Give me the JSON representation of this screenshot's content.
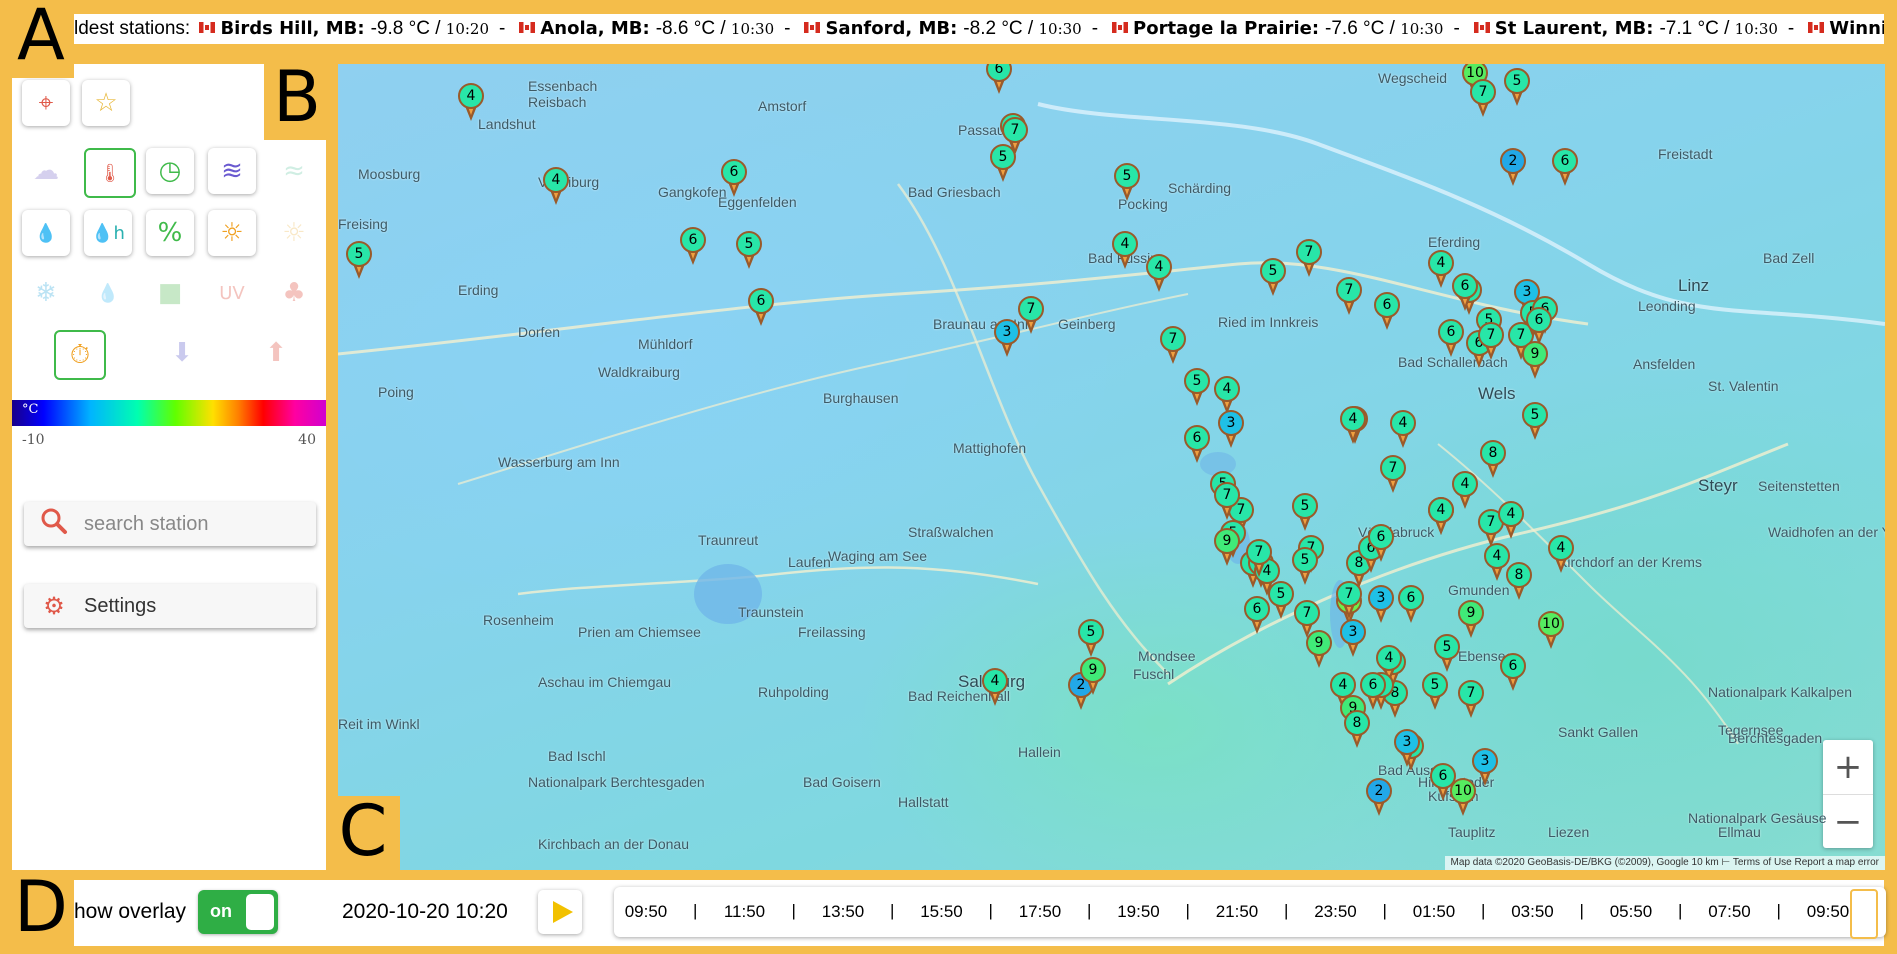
{
  "panel_labels": [
    "A",
    "B",
    "C",
    "D"
  ],
  "ticker": {
    "prefix": "ldest stations:",
    "items": [
      {
        "name": "Birds Hill, MB:",
        "temp": "-9.8 °C",
        "time": "10:20"
      },
      {
        "name": "Anola, MB:",
        "temp": "-8.6 °C",
        "time": "10:30"
      },
      {
        "name": "Sanford, MB:",
        "temp": "-8.2 °C",
        "time": "10:30"
      },
      {
        "name": "Portage la Prairie:",
        "temp": "-7.6 °C",
        "time": "10:30"
      },
      {
        "name": "St Laurent, MB:",
        "temp": "-7.1 °C",
        "time": "10:30"
      },
      {
        "name": "Winnipeg, MB :",
        "temp": "",
        "time": ""
      }
    ]
  },
  "sidebar": {
    "icons": [
      {
        "name": "locate-icon",
        "glyph": "⌖",
        "color": "#e05a4a",
        "faded": false
      },
      {
        "name": "star-icon",
        "glyph": "☆",
        "color": "#e8b83a",
        "faded": false
      },
      {
        "name": "cloud-icon",
        "glyph": "☁",
        "color": "#8a7ad0",
        "faded": true
      },
      {
        "name": "thermometer-icon",
        "glyph": "🌡",
        "color": "#e05a4a",
        "faded": false,
        "active": true
      },
      {
        "name": "gauge-icon",
        "glyph": "◷",
        "color": "#3fba4a",
        "faded": false
      },
      {
        "name": "wind-icon",
        "glyph": "≋",
        "color": "#6a5ad0",
        "faded": false
      },
      {
        "name": "fog-icon",
        "glyph": "≈",
        "color": "#7ad0b0",
        "faded": true
      },
      {
        "name": "water-drop-icon",
        "glyph": "💧",
        "color": "#2a3ad0",
        "faded": false
      },
      {
        "name": "humidity-icon",
        "glyph": "💧h",
        "color": "#2ab0b0",
        "faded": false
      },
      {
        "name": "percent-icon",
        "glyph": "%",
        "color": "#3fba4a",
        "faded": false
      },
      {
        "name": "sun-icon",
        "glyph": "☼",
        "color": "#f0a020",
        "faded": false
      },
      {
        "name": "sun-faded-icon",
        "glyph": "☼",
        "color": "#f0c060",
        "faded": true
      },
      {
        "name": "snowflake-icon",
        "glyph": "❄",
        "color": "#40b0e0",
        "faded": true
      },
      {
        "name": "dew-icon",
        "glyph": "💧",
        "color": "#60c060",
        "faded": true
      },
      {
        "name": "camera-icon",
        "glyph": "■",
        "color": "#60c060",
        "faded": true
      },
      {
        "name": "uv-icon",
        "glyph": "UV",
        "color": "#e05a4a",
        "faded": true
      },
      {
        "name": "people-icon",
        "glyph": "♣",
        "color": "#e05a4a",
        "faded": true
      },
      {
        "name": "timer-icon",
        "glyph": "⏱",
        "color": "#f0a020",
        "faded": false,
        "active": true
      },
      {
        "name": "arrow-down-icon",
        "glyph": "⬇",
        "color": "#6a6ad0",
        "faded": true
      },
      {
        "name": "arrow-up-icon",
        "glyph": "⬆",
        "color": "#e05a4a",
        "faded": true
      }
    ],
    "colorbar": {
      "unit": "°C",
      "min": "-10",
      "max": "40"
    },
    "search_placeholder": "search station",
    "settings_label": "Settings"
  },
  "map": {
    "places": [
      {
        "label": "Essenbach",
        "big": false
      },
      {
        "label": "Landshut",
        "big": false
      },
      {
        "label": "Reisbach",
        "big": false
      },
      {
        "label": "Amstorf",
        "big": false
      },
      {
        "label": "Moosburg",
        "big": false
      },
      {
        "label": "Vilsbiburg",
        "big": false
      },
      {
        "label": "Gangkofen",
        "big": false
      },
      {
        "label": "Eggenfelden",
        "big": false
      },
      {
        "label": "Bad Griesbach",
        "big": false
      },
      {
        "label": "Schärding",
        "big": false
      },
      {
        "label": "Passau",
        "big": false
      },
      {
        "label": "Wegscheid",
        "big": false
      },
      {
        "label": "Freistadt",
        "big": false
      },
      {
        "label": "Freising",
        "big": false
      },
      {
        "label": "Erding",
        "big": false
      },
      {
        "label": "Dorfen",
        "big": false
      },
      {
        "label": "Mühldorf",
        "big": false
      },
      {
        "label": "Pocking",
        "big": false
      },
      {
        "label": "Bad Füssing",
        "big": false
      },
      {
        "label": "Braunau am Inn",
        "big": false
      },
      {
        "label": "Geinberg",
        "big": false
      },
      {
        "label": "Ried im Innkreis",
        "big": false
      },
      {
        "label": "Eferding",
        "big": false
      },
      {
        "label": "Linz",
        "big": true
      },
      {
        "label": "Leonding",
        "big": false
      },
      {
        "label": "Bad Zell",
        "big": false
      },
      {
        "label": "Poing",
        "big": false
      },
      {
        "label": "Waldkraiburg",
        "big": false
      },
      {
        "label": "Burghausen",
        "big": false
      },
      {
        "label": "Bad Schallerbach",
        "big": false
      },
      {
        "label": "Ansfelden",
        "big": false
      },
      {
        "label": "St. Valentin",
        "big": false
      },
      {
        "label": "Wels",
        "big": true
      },
      {
        "label": "Mattighofen",
        "big": false
      },
      {
        "label": "Wasserburg am Inn",
        "big": false
      },
      {
        "label": "Traunreut",
        "big": false
      },
      {
        "label": "Waging am See",
        "big": false
      },
      {
        "label": "Straßwalchen",
        "big": false
      },
      {
        "label": "Vöcklabruck",
        "big": false
      },
      {
        "label": "Kirchdorf an der Krems",
        "big": false
      },
      {
        "label": "Steyr",
        "big": true
      },
      {
        "label": "Seitenstetten",
        "big": false
      },
      {
        "label": "Waidhofen an der Ybbs",
        "big": false
      },
      {
        "label": "Laufen",
        "big": false
      },
      {
        "label": "Freilassing",
        "big": false
      },
      {
        "label": "Rosenheim",
        "big": false
      },
      {
        "label": "Prien am Chiemsee",
        "big": false
      },
      {
        "label": "Traunstein",
        "big": false
      },
      {
        "label": "Mondsee",
        "big": false
      },
      {
        "label": "Gmunden",
        "big": false
      },
      {
        "label": "Salzburg",
        "big": true
      },
      {
        "label": "Fuschl",
        "big": false
      },
      {
        "label": "Ebensee",
        "big": false
      },
      {
        "label": "Aschau im Chiemgau",
        "big": false
      },
      {
        "label": "Ruhpolding",
        "big": false
      },
      {
        "label": "Bad Reichenhall",
        "big": false
      },
      {
        "label": "Hallein",
        "big": false
      },
      {
        "label": "Nationalpark Kalkalpen",
        "big": false
      },
      {
        "label": "Tegernsee",
        "big": false
      },
      {
        "label": "Reit im Winkl",
        "big": false
      },
      {
        "label": "Bad Ischl",
        "big": false
      },
      {
        "label": "Hinterstoder",
        "big": false
      },
      {
        "label": "Sankt Gallen",
        "big": false
      },
      {
        "label": "Berchtesgaden",
        "big": false
      },
      {
        "label": "Bad Goisern",
        "big": false
      },
      {
        "label": "Bad Aussee",
        "big": false
      },
      {
        "label": "Kufstein",
        "big": false
      },
      {
        "label": "Nationalpark Berchtesgaden",
        "big": false
      },
      {
        "label": "Hallstatt",
        "big": false
      },
      {
        "label": "Tauplitz",
        "big": false
      },
      {
        "label": "Liezen",
        "big": false
      },
      {
        "label": "Nationalpark Gesäuse",
        "big": false
      },
      {
        "label": "Ellmau",
        "big": false
      },
      {
        "label": "Kirchbach an der Donau",
        "big": false
      }
    ],
    "markers": [
      {
        "value": 4
      },
      {
        "value": 4
      },
      {
        "value": 5
      },
      {
        "value": 6
      },
      {
        "value": 6
      },
      {
        "value": 5
      },
      {
        "value": 6
      },
      {
        "value": 6
      },
      {
        "value": 5
      },
      {
        "value": 5
      },
      {
        "value": 7
      },
      {
        "value": 5
      },
      {
        "value": 2
      },
      {
        "value": 10
      },
      {
        "value": 7
      },
      {
        "value": 5
      },
      {
        "value": 4
      },
      {
        "value": 6
      },
      {
        "value": 3
      },
      {
        "value": 7
      },
      {
        "value": 5
      },
      {
        "value": 6
      },
      {
        "value": 4
      },
      {
        "value": 6
      },
      {
        "value": 6
      },
      {
        "value": 5
      },
      {
        "value": 6
      },
      {
        "value": 7
      },
      {
        "value": 6
      },
      {
        "value": 6
      },
      {
        "value": 5
      },
      {
        "value": 7
      },
      {
        "value": 7
      },
      {
        "value": 5
      },
      {
        "value": 4
      },
      {
        "value": 4
      },
      {
        "value": 7
      },
      {
        "value": 6
      },
      {
        "value": 7
      },
      {
        "value": 8
      },
      {
        "value": 9
      },
      {
        "value": 5
      },
      {
        "value": 4
      },
      {
        "value": 3
      },
      {
        "value": 5
      },
      {
        "value": 6
      },
      {
        "value": 5
      },
      {
        "value": 7
      },
      {
        "value": 7
      },
      {
        "value": 5
      },
      {
        "value": 3
      },
      {
        "value": 9
      },
      {
        "value": 7
      },
      {
        "value": 4
      },
      {
        "value": 6
      },
      {
        "value": 4
      },
      {
        "value": 4
      },
      {
        "value": 6
      },
      {
        "value": 5
      },
      {
        "value": 5
      },
      {
        "value": 4
      },
      {
        "value": 7
      },
      {
        "value": 4
      },
      {
        "value": 5
      },
      {
        "value": 8
      },
      {
        "value": 4
      },
      {
        "value": 7
      },
      {
        "value": 11
      },
      {
        "value": 3
      },
      {
        "value": 6
      },
      {
        "value": 6
      },
      {
        "value": 4
      },
      {
        "value": 2
      },
      {
        "value": 8
      },
      {
        "value": 7
      },
      {
        "value": 8
      },
      {
        "value": 9
      },
      {
        "value": 3
      },
      {
        "value": 6
      },
      {
        "value": 9
      },
      {
        "value": 10
      },
      {
        "value": 5
      },
      {
        "value": 9
      },
      {
        "value": 7
      },
      {
        "value": 7
      },
      {
        "value": 3
      },
      {
        "value": 9
      },
      {
        "value": 7
      },
      {
        "value": 4
      },
      {
        "value": 4
      },
      {
        "value": 5
      },
      {
        "value": 6
      },
      {
        "value": 10
      },
      {
        "value": 8
      },
      {
        "value": 8
      },
      {
        "value": 3
      },
      {
        "value": 2
      },
      {
        "value": 5
      },
      {
        "value": 4
      },
      {
        "value": 6
      },
      {
        "value": 7
      },
      {
        "value": 5
      },
      {
        "value": 4
      },
      {
        "value": 4
      },
      {
        "value": 6
      }
    ],
    "zoom_in": "+",
    "zoom_out": "−",
    "attribution": "Map data ©2020 GeoBasis-DE/BKG (©2009), Google   10 km ⊢   Terms of Use   Report a map error"
  },
  "bottom": {
    "overlay_label": "how overlay",
    "toggle_label": "on",
    "datetime": "2020-10-20 10:20",
    "timeline": [
      "09:50",
      "11:50",
      "13:50",
      "15:50",
      "17:50",
      "19:50",
      "21:50",
      "23:50",
      "01:50",
      "03:50",
      "05:50",
      "07:50",
      "09:50"
    ]
  }
}
